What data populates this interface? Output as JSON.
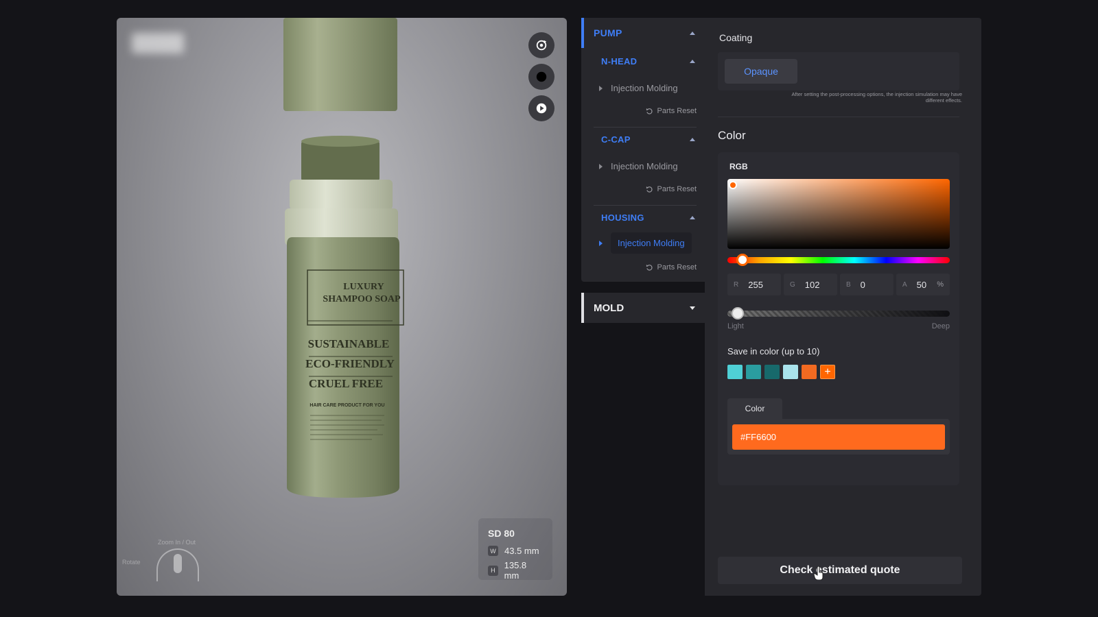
{
  "viewer": {
    "product_label": {
      "line1": "LUXURY",
      "line2": "SHAMPOO SOAP",
      "claims": [
        "SUSTAINABLE",
        "ECO-FRIENDLY",
        "CRUEL FREE"
      ],
      "subtitle": "HAIR CARE PRODUCT FOR YOU"
    },
    "controls": {
      "rotate_icon": "rotate-icon",
      "record_icon": "record-icon",
      "play_icon": "play-icon"
    },
    "dimensions": {
      "title": "SD 80",
      "w_tag": "W",
      "width": "43.5 mm",
      "h_tag": "H",
      "height": "135.8 mm"
    },
    "hint": {
      "zoom": "Zoom In / Out",
      "rotate": "Rotate"
    }
  },
  "parts": {
    "pump": "PUMP",
    "groups": [
      {
        "name": "N-HEAD",
        "process": "Injection Molding",
        "reset": "Parts Reset"
      },
      {
        "name": "C-CAP",
        "process": "Injection Molding",
        "reset": "Parts Reset"
      },
      {
        "name": "HOUSING",
        "process": "Injection Molding",
        "reset": "Parts Reset"
      }
    ],
    "mold": "MOLD"
  },
  "panel": {
    "coating_label": "Coating",
    "coating_option": "Opaque",
    "note": "After setting the post-processing options, the injection simulation may have different effects.",
    "color_heading": "Color",
    "mode": "RGB",
    "r_label": "R",
    "r": "255",
    "g_label": "G",
    "g": "102",
    "b_label": "B",
    "b": "0",
    "a_label": "A",
    "a": "50",
    "a_unit": "%",
    "hue_deg": 24,
    "light_label": "Light",
    "deep_label": "Deep",
    "save_label": "Save in color (up to 10)",
    "swatches": [
      "#4fd0d6",
      "#2a9da0",
      "#17696b",
      "#a9e3ec",
      "#f26a21"
    ],
    "add_symbol": "+",
    "color_tab": "Color",
    "hex": "#FF6600",
    "quote_button": "Check estimated quote"
  },
  "colors": {
    "accent": "#3f7ef7",
    "selected": "#ff6600"
  }
}
